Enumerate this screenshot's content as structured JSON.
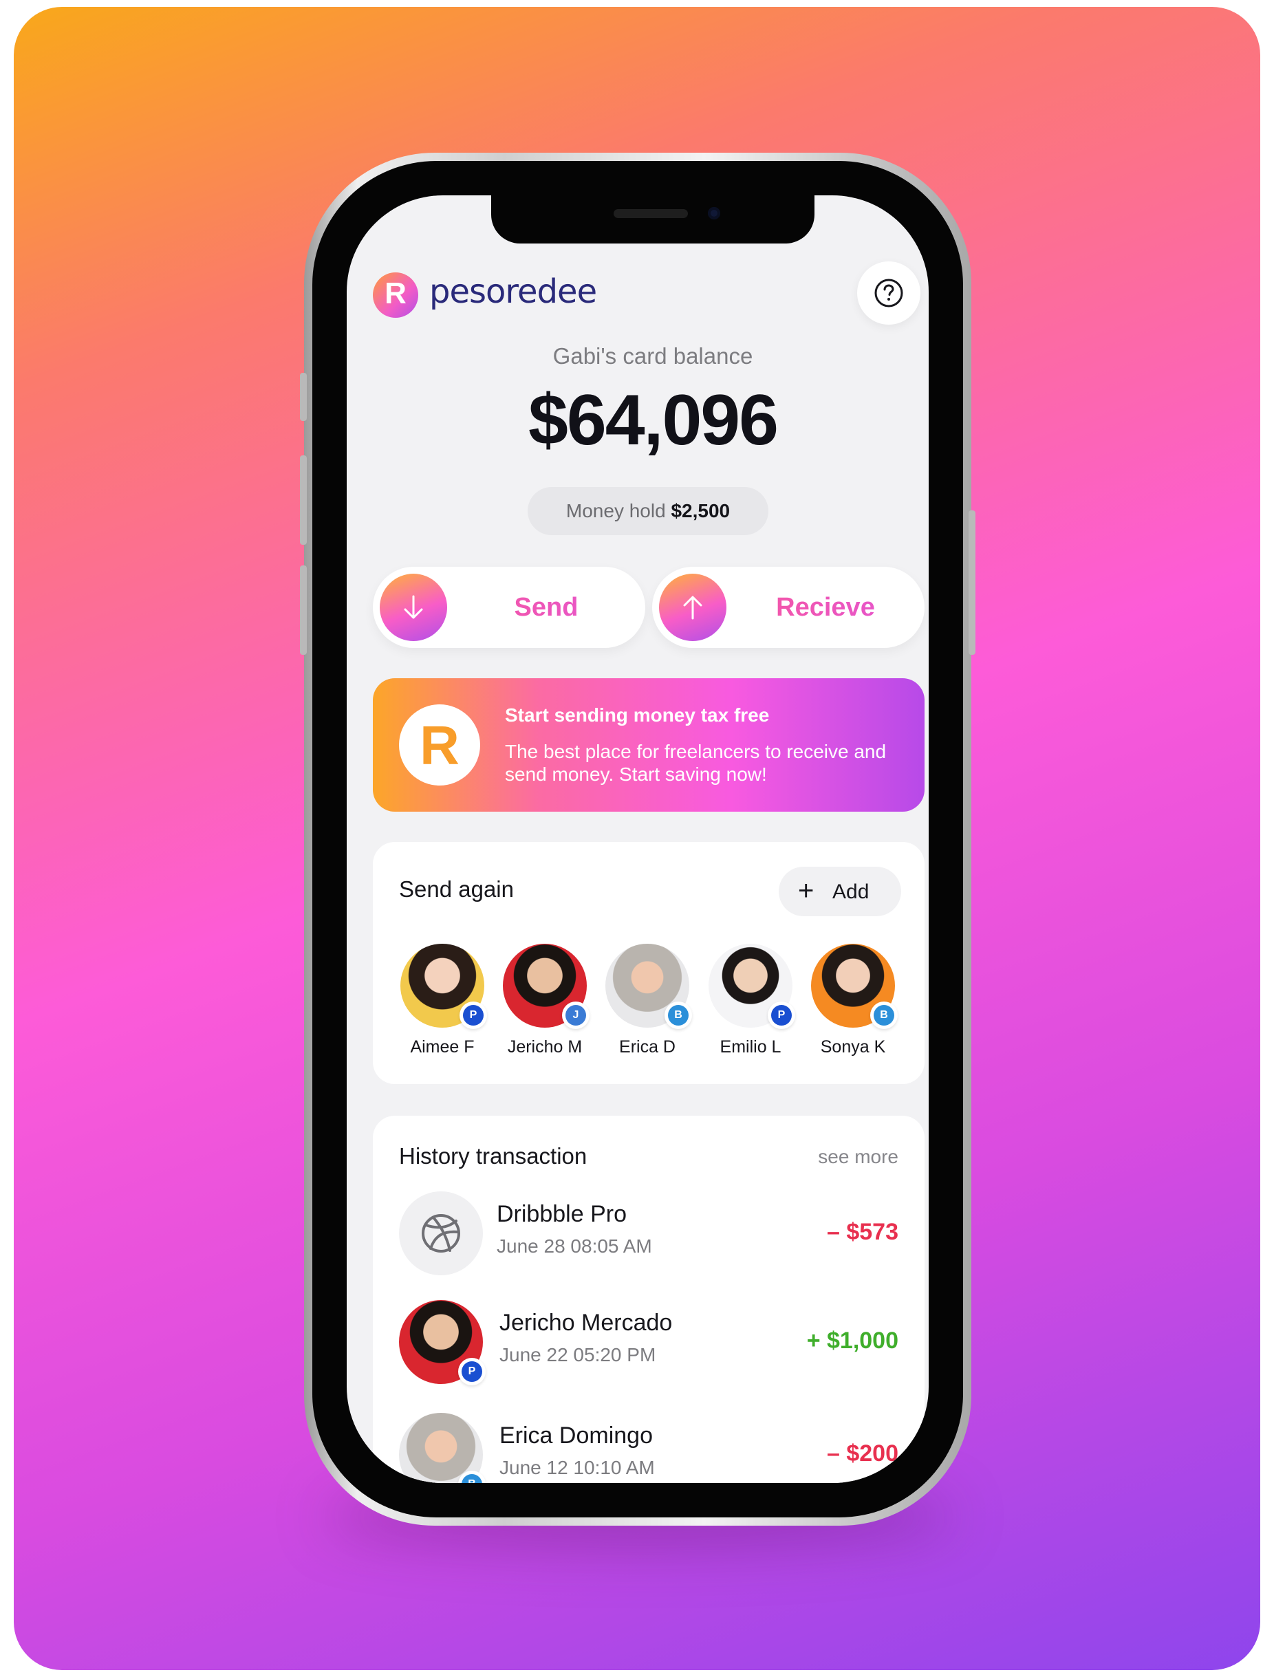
{
  "brand": {
    "name": "pesoredee",
    "logo_letter": "R"
  },
  "header": {
    "help_icon": "question-circle-icon"
  },
  "balance": {
    "label": "Gabi's card balance",
    "amount": "$64,096",
    "hold_label": "Money hold",
    "hold_amount": "$2,500"
  },
  "actions": {
    "send_label": "Send",
    "send_icon": "arrow-down-icon",
    "receive_label": "Recieve",
    "receive_icon": "arrow-up-icon"
  },
  "promo": {
    "title": "Start sending money tax free",
    "description": "The best place for freelancers to receive and send money. Start saving now!"
  },
  "send_again": {
    "title": "Send again",
    "add_label": "Add",
    "contacts": [
      {
        "name": "Aimee F",
        "badge": "paypal-icon",
        "badge_text": "P",
        "badge_color": "#1a4fd1"
      },
      {
        "name": "Jericho M",
        "badge": "jcb-card-icon",
        "badge_text": "J",
        "badge_color": "#3a7bd5"
      },
      {
        "name": "Erica D",
        "badge": "bank-icon",
        "badge_text": "B",
        "badge_color": "#2b8fd9"
      },
      {
        "name": "Emilio L",
        "badge": "paypal-icon",
        "badge_text": "P",
        "badge_color": "#1a4fd1"
      },
      {
        "name": "Sonya K",
        "badge": "bank-icon",
        "badge_text": "B",
        "badge_color": "#2b8fd9"
      }
    ]
  },
  "history": {
    "title": "History transaction",
    "see_more": "see more",
    "items": [
      {
        "title": "Dribbble Pro",
        "date": "June 28 08:05 AM",
        "amount": "– $573",
        "type": "debit",
        "icon": "dribbble-icon"
      },
      {
        "title": "Jericho Mercado",
        "date": "June 22 05:20 PM",
        "amount": "+ $1,000",
        "type": "credit",
        "icon": "avatar",
        "badge_text": "P"
      },
      {
        "title": "Erica Domingo",
        "date": "June 12 10:10 AM",
        "amount": "– $200",
        "type": "debit",
        "icon": "avatar",
        "badge_text": "B"
      }
    ]
  },
  "colors": {
    "debit": "#e8304f",
    "credit": "#3fae2b",
    "accent_orange": "#fca629",
    "accent_pink": "#f85ae0",
    "accent_purple": "#b74ae8"
  }
}
